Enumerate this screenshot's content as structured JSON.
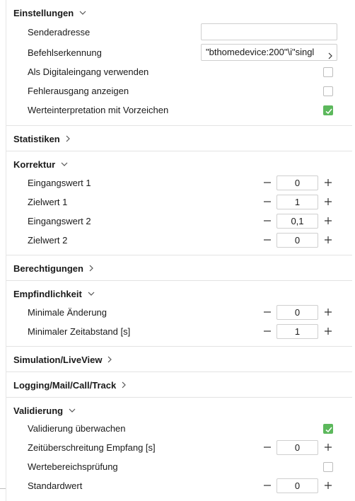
{
  "settings": {
    "title": "Einstellungen",
    "sender_label": "Senderadresse",
    "sender_value": "",
    "command_label": "Befehlserkennung",
    "command_value": "\"bthomedevice:200\"\\i\"singl",
    "digital_label": "Als Digitaleingang verwenden",
    "digital_checked": false,
    "error_label": "Fehlerausgang anzeigen",
    "error_checked": false,
    "signed_label": "Werteinterpretation mit Vorzeichen",
    "signed_checked": true
  },
  "statistics": {
    "title": "Statistiken"
  },
  "correction": {
    "title": "Korrektur",
    "rows": [
      {
        "label": "Eingangswert 1",
        "value": "0"
      },
      {
        "label": "Zielwert 1",
        "value": "1"
      },
      {
        "label": "Eingangswert 2",
        "value": "0,1"
      },
      {
        "label": "Zielwert 2",
        "value": "0"
      }
    ]
  },
  "permissions": {
    "title": "Berechtigungen"
  },
  "sensitivity": {
    "title": "Empfindlichkeit",
    "rows": [
      {
        "label": "Minimale Änderung",
        "value": "0"
      },
      {
        "label": "Minimaler Zeitabstand [s]",
        "value": "1"
      }
    ]
  },
  "simulation": {
    "title": "Simulation/LiveView"
  },
  "logging": {
    "title": "Logging/Mail/Call/Track"
  },
  "validation": {
    "title": "Validierung",
    "monitor_label": "Validierung überwachen",
    "monitor_checked": true,
    "timeout_label": "Zeitüberschreitung Empfang [s]",
    "timeout_value": "0",
    "range_label": "Wertebereichsprüfung",
    "range_checked": false,
    "default_label": "Standardwert",
    "default_value": "0"
  },
  "colors": {
    "check_on": "#5cb85c",
    "border": "#cfcfcf",
    "divider": "#e3e3e3"
  }
}
